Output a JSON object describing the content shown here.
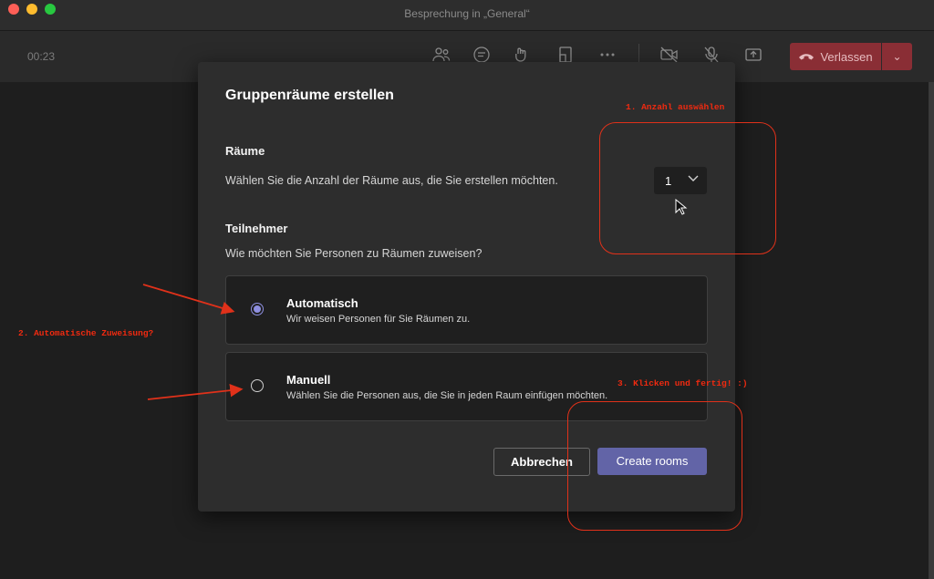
{
  "window": {
    "title": "Besprechung in „General“"
  },
  "toolbar": {
    "timer": "00:23",
    "icons": [
      "people-icon",
      "chat-icon",
      "reactions-icon",
      "rooms-icon",
      "more-icon",
      "camera-off-icon",
      "mic-off-icon",
      "share-icon"
    ],
    "leave_label": "Verlassen",
    "leave_color": "#8a2e35"
  },
  "dialog": {
    "title": "Gruppenräume erstellen",
    "rooms_label": "Räume",
    "rooms_text": "Wählen Sie die Anzahl der Räume aus, die Sie erstellen möchten.",
    "room_count": "1",
    "participants_label": "Teilnehmer",
    "participants_text": "Wie möchten Sie Personen zu Räumen zuweisen?",
    "options": [
      {
        "title": "Automatisch",
        "desc": "Wir weisen Personen für Sie Räumen zu.",
        "checked": true
      },
      {
        "title": "Manuell",
        "desc": "Wählen Sie die Personen aus, die Sie in jeden Raum einfügen möchten.",
        "checked": false
      }
    ],
    "cancel_label": "Abbrechen",
    "create_label": "Create rooms",
    "accent": "#6264a7"
  },
  "annotations": {
    "step1": "1. Anzahl auswählen",
    "step2": "2. Automatische Zuweisung?",
    "step3": "3. Klicken und fertig! :)",
    "color": "#f02a10"
  }
}
